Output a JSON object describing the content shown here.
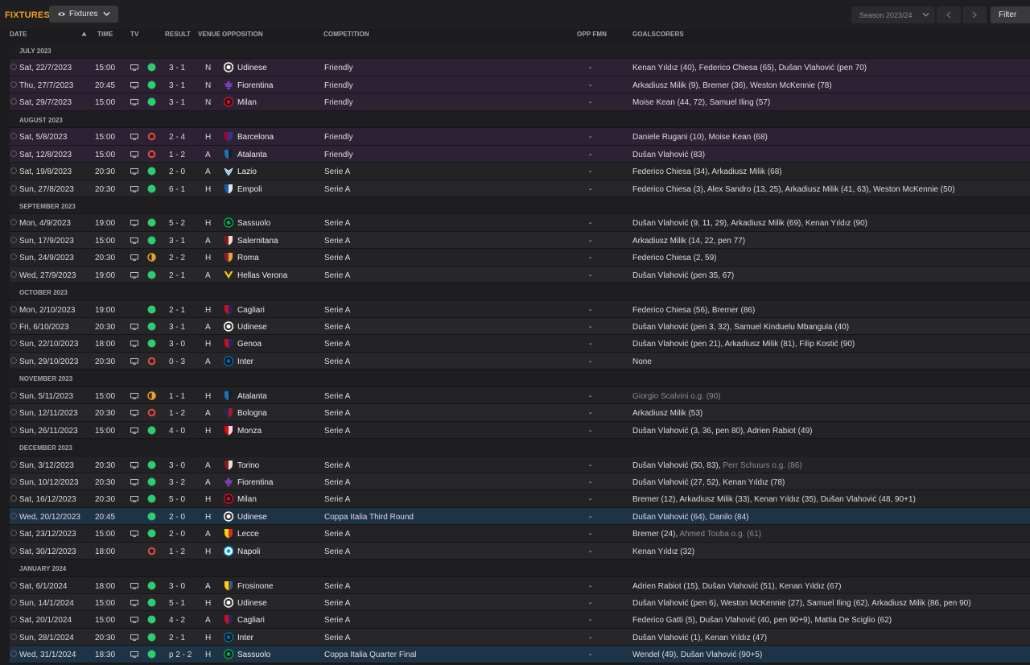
{
  "header": {
    "title": "FIXTURES",
    "view_dropdown": "Fixtures",
    "season": "Season 2023/24",
    "filter_label": "Filter"
  },
  "columns": {
    "date": "Date",
    "time": "Time",
    "tv": "TV",
    "result": "Result",
    "venue": "Venue",
    "opposition": "Opposition",
    "competition": "Competition",
    "opp_fmn": "Opp FMN",
    "goalscorers": "Goalscorers"
  },
  "colors": {
    "win": "#2ecc71",
    "loss": "#e74c3c",
    "draw": "#f0a020",
    "title": "#f0a020",
    "friendly_row": "#2d2233",
    "cup_row": "#1f3347"
  },
  "groups": [
    {
      "month": "JULY 2023",
      "matches": [
        {
          "date": "Sat, 22/7/2023",
          "time": "15:00",
          "tv": true,
          "outcome": "win",
          "score": "3 - 1",
          "venue": "N",
          "opponent": "Udinese",
          "badge": "udinese",
          "competition": "Friendly",
          "fmn": "-",
          "scorers": [
            {
              "t": "Kenan Yıldız (40), Federico Chiesa (65), Dušan Vlahović (pen 70)"
            }
          ]
        },
        {
          "date": "Thu, 27/7/2023",
          "time": "20:45",
          "tv": true,
          "outcome": "win",
          "score": "3 - 1",
          "venue": "N",
          "opponent": "Fiorentina",
          "badge": "fiorentina",
          "competition": "Friendly",
          "fmn": "-",
          "scorers": [
            {
              "t": "Arkadiusz Milik (9), Bremer (36), Weston McKennie (78)"
            }
          ]
        },
        {
          "date": "Sat, 29/7/2023",
          "time": "15:00",
          "tv": true,
          "outcome": "win",
          "score": "3 - 1",
          "venue": "N",
          "opponent": "Milan",
          "badge": "milan",
          "competition": "Friendly",
          "fmn": "-",
          "scorers": [
            {
              "t": "Moise Kean (44, 72), Samuel Iling (57)"
            }
          ]
        }
      ]
    },
    {
      "month": "AUGUST 2023",
      "matches": [
        {
          "date": "Sat, 5/8/2023",
          "time": "15:00",
          "tv": true,
          "outcome": "loss",
          "score": "2 - 4",
          "venue": "H",
          "opponent": "Barcelona",
          "badge": "barcelona",
          "competition": "Friendly",
          "fmn": "-",
          "scorers": [
            {
              "t": "Daniele Rugani (10), Moise Kean (68)"
            }
          ]
        },
        {
          "date": "Sat, 12/8/2023",
          "time": "15:00",
          "tv": true,
          "outcome": "loss",
          "score": "1 - 2",
          "venue": "A",
          "opponent": "Atalanta",
          "badge": "atalanta",
          "competition": "Friendly",
          "fmn": "-",
          "scorers": [
            {
              "t": "Dušan Vlahović (83)"
            }
          ]
        },
        {
          "date": "Sat, 19/8/2023",
          "time": "20:30",
          "tv": true,
          "outcome": "win",
          "score": "2 - 0",
          "venue": "A",
          "opponent": "Lazio",
          "badge": "lazio",
          "competition": "Serie A",
          "fmn": "-",
          "scorers": [
            {
              "t": "Federico Chiesa (34), Arkadiusz Milik (68)"
            }
          ]
        },
        {
          "date": "Sun, 27/8/2023",
          "time": "20:30",
          "tv": true,
          "outcome": "win",
          "score": "6 - 1",
          "venue": "H",
          "opponent": "Empoli",
          "badge": "empoli",
          "competition": "Serie A",
          "fmn": "-",
          "scorers": [
            {
              "t": "Federico Chiesa (3), Alex Sandro (13, 25), Arkadiusz Milik (41, 63), Weston McKennie (50)"
            }
          ]
        }
      ]
    },
    {
      "month": "SEPTEMBER 2023",
      "matches": [
        {
          "date": "Mon, 4/9/2023",
          "time": "19:00",
          "tv": true,
          "outcome": "win",
          "score": "5 - 2",
          "venue": "H",
          "opponent": "Sassuolo",
          "badge": "sassuolo",
          "competition": "Serie A",
          "fmn": "-",
          "scorers": [
            {
              "t": "Dušan Vlahović (9, 11, 29), Arkadiusz Milik (69), Kenan Yıldız (90)"
            }
          ]
        },
        {
          "date": "Sun, 17/9/2023",
          "time": "15:00",
          "tv": true,
          "outcome": "win",
          "score": "3 - 1",
          "venue": "A",
          "opponent": "Salernitana",
          "badge": "salernitana",
          "competition": "Serie A",
          "fmn": "-",
          "scorers": [
            {
              "t": "Arkadiusz Milik (14, 22, pen 77)"
            }
          ]
        },
        {
          "date": "Sun, 24/9/2023",
          "time": "20:30",
          "tv": true,
          "outcome": "draw",
          "score": "2 - 2",
          "venue": "H",
          "opponent": "Roma",
          "badge": "roma",
          "competition": "Serie A",
          "fmn": "-",
          "scorers": [
            {
              "t": "Federico Chiesa (2, 59)"
            }
          ]
        },
        {
          "date": "Wed, 27/9/2023",
          "time": "19:00",
          "tv": true,
          "outcome": "win",
          "score": "2 - 1",
          "venue": "A",
          "opponent": "Hellas Verona",
          "badge": "verona",
          "competition": "Serie A",
          "fmn": "-",
          "scorers": [
            {
              "t": "Dušan Vlahović (pen 35, 67)"
            }
          ]
        }
      ]
    },
    {
      "month": "OCTOBER 2023",
      "matches": [
        {
          "date": "Mon, 2/10/2023",
          "time": "19:00",
          "tv": false,
          "outcome": "win",
          "score": "2 - 1",
          "venue": "H",
          "opponent": "Cagliari",
          "badge": "cagliari",
          "competition": "Serie A",
          "fmn": "-",
          "scorers": [
            {
              "t": "Federico Chiesa (56), Bremer (86)"
            }
          ]
        },
        {
          "date": "Fri, 6/10/2023",
          "time": "20:30",
          "tv": true,
          "outcome": "win",
          "score": "3 - 1",
          "venue": "A",
          "opponent": "Udinese",
          "badge": "udinese",
          "competition": "Serie A",
          "fmn": "-",
          "scorers": [
            {
              "t": "Dušan Vlahović (pen 3, 32), Samuel Kinduelu Mbangula (40)"
            }
          ]
        },
        {
          "date": "Sun, 22/10/2023",
          "time": "18:00",
          "tv": true,
          "outcome": "win",
          "score": "3 - 0",
          "venue": "H",
          "opponent": "Genoa",
          "badge": "genoa",
          "competition": "Serie A",
          "fmn": "-",
          "scorers": [
            {
              "t": "Dušan Vlahović (pen 21), Arkadiusz Milik (81), Filip Kostić (90)"
            }
          ]
        },
        {
          "date": "Sun, 29/10/2023",
          "time": "20:30",
          "tv": true,
          "outcome": "loss",
          "score": "0 - 3",
          "venue": "A",
          "opponent": "Inter",
          "badge": "inter",
          "competition": "Serie A",
          "fmn": "-",
          "scorers": [
            {
              "t": "None"
            }
          ]
        }
      ]
    },
    {
      "month": "NOVEMBER 2023",
      "matches": [
        {
          "date": "Sun, 5/11/2023",
          "time": "15:00",
          "tv": true,
          "outcome": "draw",
          "score": "1 - 1",
          "venue": "H",
          "opponent": "Atalanta",
          "badge": "atalanta",
          "competition": "Serie A",
          "fmn": "-",
          "scorers": [
            {
              "t": "Giorgio Scalvini o.g. (90)",
              "og": true
            }
          ]
        },
        {
          "date": "Sun, 12/11/2023",
          "time": "20:30",
          "tv": true,
          "outcome": "loss",
          "score": "1 - 2",
          "venue": "A",
          "opponent": "Bologna",
          "badge": "bologna",
          "competition": "Serie A",
          "fmn": "-",
          "scorers": [
            {
              "t": "Arkadiusz Milik (53)"
            }
          ]
        },
        {
          "date": "Sun, 26/11/2023",
          "time": "15:00",
          "tv": true,
          "outcome": "win",
          "score": "4 - 0",
          "venue": "H",
          "opponent": "Monza",
          "badge": "monza",
          "competition": "Serie A",
          "fmn": "-",
          "scorers": [
            {
              "t": "Dušan Vlahović (3, 36, pen 80), Adrien Rabiot (49)"
            }
          ]
        }
      ]
    },
    {
      "month": "DECEMBER 2023",
      "matches": [
        {
          "date": "Sun, 3/12/2023",
          "time": "20:30",
          "tv": true,
          "outcome": "win",
          "score": "3 - 0",
          "venue": "A",
          "opponent": "Torino",
          "badge": "torino",
          "competition": "Serie A",
          "fmn": "-",
          "scorers": [
            {
              "t": "Dušan Vlahović (50, 83), "
            },
            {
              "t": "Perr Schuurs o.g. (86)",
              "og": true
            }
          ]
        },
        {
          "date": "Sun, 10/12/2023",
          "time": "20:30",
          "tv": true,
          "outcome": "win",
          "score": "3 - 2",
          "venue": "A",
          "opponent": "Fiorentina",
          "badge": "fiorentina",
          "competition": "Serie A",
          "fmn": "-",
          "scorers": [
            {
              "t": "Dušan Vlahović (27, 52), Kenan Yıldız (78)"
            }
          ]
        },
        {
          "date": "Sat, 16/12/2023",
          "time": "20:30",
          "tv": true,
          "outcome": "win",
          "score": "5 - 0",
          "venue": "H",
          "opponent": "Milan",
          "badge": "milan",
          "competition": "Serie A",
          "fmn": "-",
          "scorers": [
            {
              "t": "Bremer (12), Arkadiusz Milik (33), Kenan Yıldız (35), Dušan Vlahović (48, 90+1)"
            }
          ]
        },
        {
          "date": "Wed, 20/12/2023",
          "time": "20:45",
          "tv": false,
          "outcome": "win",
          "score": "2 - 0",
          "venue": "H",
          "opponent": "Udinese",
          "badge": "udinese",
          "competition": "Coppa Italia Third Round",
          "fmn": "-",
          "scorers": [
            {
              "t": "Dušan Vlahović (64), Danilo (84)"
            }
          ]
        },
        {
          "date": "Sat, 23/12/2023",
          "time": "15:00",
          "tv": true,
          "outcome": "win",
          "score": "2 - 0",
          "venue": "A",
          "opponent": "Lecce",
          "badge": "lecce",
          "competition": "Serie A",
          "fmn": "-",
          "scorers": [
            {
              "t": "Bremer (24), "
            },
            {
              "t": "Ahmed Touba o.g. (61)",
              "og": true
            }
          ]
        },
        {
          "date": "Sat, 30/12/2023",
          "time": "18:00",
          "tv": false,
          "outcome": "loss",
          "score": "1 - 2",
          "venue": "H",
          "opponent": "Napoli",
          "badge": "napoli",
          "competition": "Serie A",
          "fmn": "-",
          "scorers": [
            {
              "t": "Kenan Yıldız (32)"
            }
          ]
        }
      ]
    },
    {
      "month": "JANUARY 2024",
      "matches": [
        {
          "date": "Sat, 6/1/2024",
          "time": "18:00",
          "tv": true,
          "outcome": "win",
          "score": "3 - 0",
          "venue": "A",
          "opponent": "Frosinone",
          "badge": "frosinone",
          "competition": "Serie A",
          "fmn": "-",
          "scorers": [
            {
              "t": "Adrien Rabiot (15), Dušan Vlahović (51), Kenan Yıldız (67)"
            }
          ]
        },
        {
          "date": "Sun, 14/1/2024",
          "time": "15:00",
          "tv": true,
          "outcome": "win",
          "score": "5 - 1",
          "venue": "H",
          "opponent": "Udinese",
          "badge": "udinese",
          "competition": "Serie A",
          "fmn": "-",
          "scorers": [
            {
              "t": "Dušan Vlahović (pen 6), Weston McKennie (27), Samuel Iling (62), Arkadiusz Milik (86, pen 90)"
            }
          ]
        },
        {
          "date": "Sat, 20/1/2024",
          "time": "15:00",
          "tv": true,
          "outcome": "win",
          "score": "4 - 2",
          "venue": "A",
          "opponent": "Cagliari",
          "badge": "cagliari",
          "competition": "Serie A",
          "fmn": "-",
          "scorers": [
            {
              "t": "Federico Gatti (5), Dušan Vlahović (40, pen 90+9), Mattia De Sciglio (62)"
            }
          ]
        },
        {
          "date": "Sun, 28/1/2024",
          "time": "20:30",
          "tv": true,
          "outcome": "win",
          "score": "2 - 1",
          "venue": "H",
          "opponent": "Inter",
          "badge": "inter",
          "competition": "Serie A",
          "fmn": "-",
          "scorers": [
            {
              "t": "Dušan Vlahović (1), Kenan Yıldız (47)"
            }
          ]
        },
        {
          "date": "Wed, 31/1/2024",
          "time": "18:30",
          "tv": true,
          "outcome": "win",
          "score": "p 2 - 2",
          "venue": "H",
          "opponent": "Sassuolo",
          "badge": "sassuolo",
          "competition": "Coppa Italia Quarter Final",
          "fmn": "-",
          "scorers": [
            {
              "t": "Wendel (49), Dušan Vlahović (90+5)"
            }
          ]
        }
      ]
    }
  ],
  "badges": {
    "udinese": {
      "shape": "circle",
      "c1": "#ffffff",
      "c2": "#333333"
    },
    "fiorentina": {
      "shape": "lily",
      "c1": "#7b3fb5",
      "c2": "#ffffff"
    },
    "milan": {
      "shape": "circle",
      "c1": "#c8102e",
      "c2": "#111111"
    },
    "barcelona": {
      "shape": "shield",
      "c1": "#a50044",
      "c2": "#004d98"
    },
    "atalanta": {
      "shape": "shield",
      "c1": "#1e71b8",
      "c2": "#111111"
    },
    "lazio": {
      "shape": "eagle",
      "c1": "#87ceeb",
      "c2": "#ffffff"
    },
    "empoli": {
      "shape": "shield",
      "c1": "#1b5ea8",
      "c2": "#ffffff"
    },
    "sassuolo": {
      "shape": "circle",
      "c1": "#00a752",
      "c2": "#111111"
    },
    "salernitana": {
      "shape": "shield",
      "c1": "#8b1a1a",
      "c2": "#ffffff"
    },
    "roma": {
      "shape": "shield",
      "c1": "#8e1f2f",
      "c2": "#f0bc42"
    },
    "verona": {
      "shape": "chevron",
      "c1": "#ffd200",
      "c2": "#1c3f94"
    },
    "cagliari": {
      "shape": "shield",
      "c1": "#c8102e",
      "c2": "#0a2a66"
    },
    "genoa": {
      "shape": "shield",
      "c1": "#c8102e",
      "c2": "#0a2a66"
    },
    "inter": {
      "shape": "circle",
      "c1": "#0068a8",
      "c2": "#111111"
    },
    "bologna": {
      "shape": "shield",
      "c1": "#1a2f48",
      "c2": "#c8102e"
    },
    "monza": {
      "shape": "shield",
      "c1": "#e30613",
      "c2": "#ffffff"
    },
    "torino": {
      "shape": "shield",
      "c1": "#8b1a1a",
      "c2": "#ffffff"
    },
    "lecce": {
      "shape": "shield",
      "c1": "#ffd200",
      "c2": "#c8102e"
    },
    "napoli": {
      "shape": "circle",
      "c1": "#12a0d7",
      "c2": "#ffffff"
    },
    "frosinone": {
      "shape": "shield",
      "c1": "#ffd200",
      "c2": "#1c3f94"
    }
  }
}
